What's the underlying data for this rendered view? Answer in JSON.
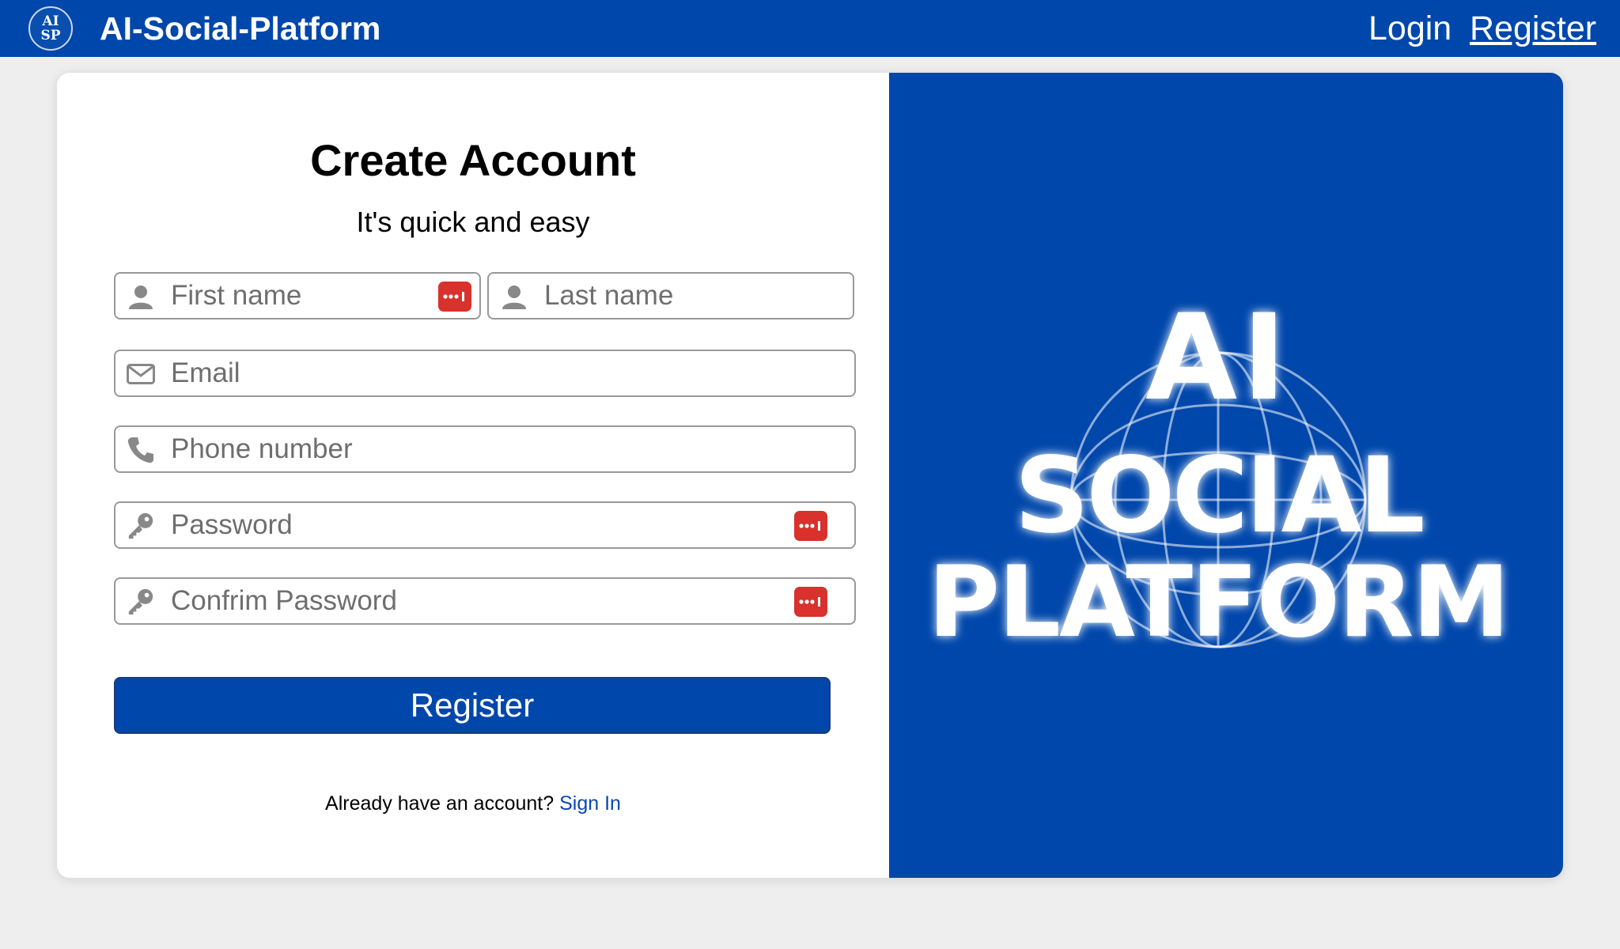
{
  "header": {
    "logo_line1": "AI",
    "logo_line2": "SP",
    "brand": "AI-Social-Platform",
    "nav_login": "Login",
    "nav_register": "Register"
  },
  "form": {
    "title": "Create Account",
    "subtitle": "It's quick and easy",
    "first_name_placeholder": "First name",
    "last_name_placeholder": "Last name",
    "email_placeholder": "Email",
    "phone_placeholder": "Phone number",
    "password_placeholder": "Password",
    "confirm_password_placeholder": "Confrim Password",
    "register_label": "Register",
    "have_account_text": "Already have an account?",
    "sign_in_label": "Sign In"
  },
  "hero": {
    "logo_line1": "AI",
    "logo_line2": "SOCIAL",
    "logo_line3": "PLATFORM"
  },
  "colors": {
    "brand_blue": "#0047ab",
    "password_manager_red": "#d9312b",
    "link_blue": "#0a47b0"
  }
}
